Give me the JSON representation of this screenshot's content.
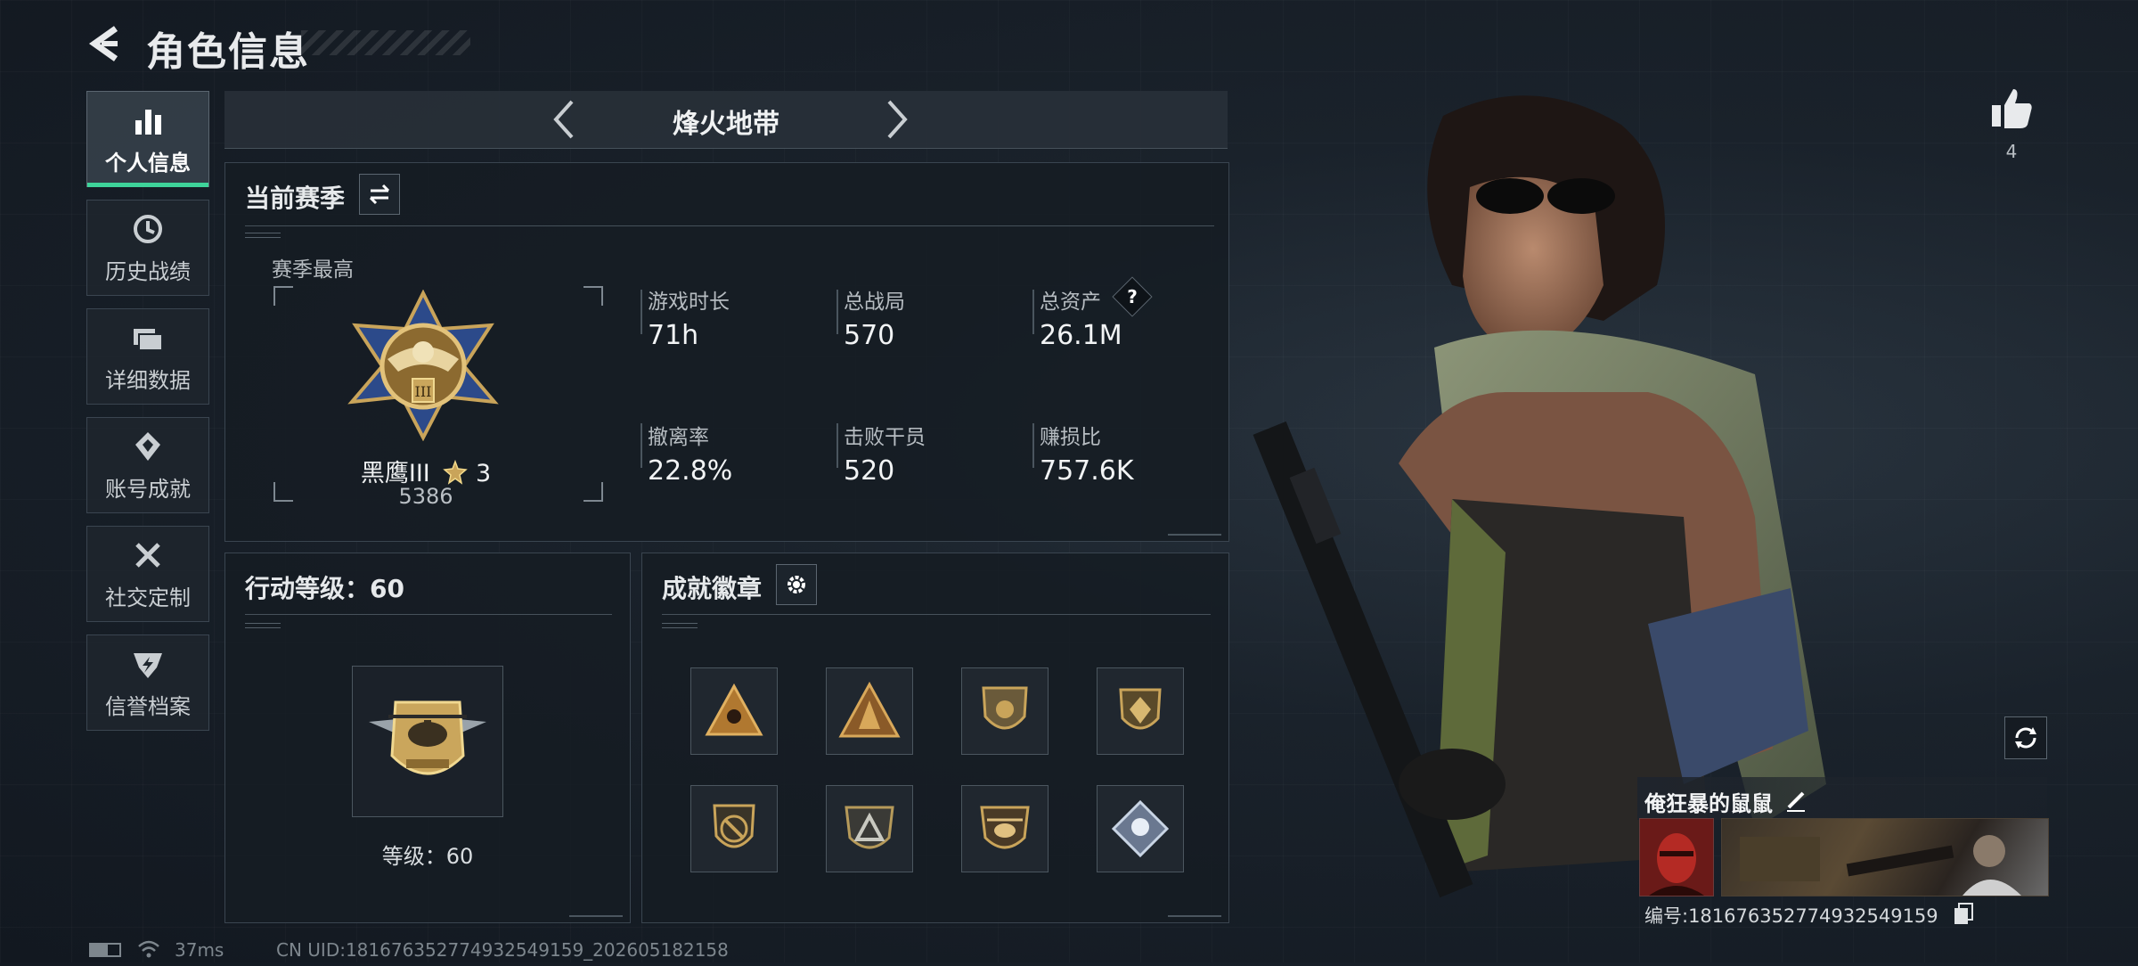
{
  "header": {
    "title": "角色信息"
  },
  "sidebar": {
    "items": [
      {
        "label": "个人信息"
      },
      {
        "label": "历史战绩"
      },
      {
        "label": "详细数据"
      },
      {
        "label": "账号成就"
      },
      {
        "label": "社交定制"
      },
      {
        "label": "信誉档案"
      }
    ]
  },
  "map_selector": {
    "name": "烽火地带"
  },
  "season": {
    "title": "当前赛季",
    "best_label": "赛季最高",
    "rank_name": "黑鹰III",
    "rank_stars": "3",
    "rank_points": "5386",
    "stats": [
      {
        "label": "游戏时长",
        "value": "71h"
      },
      {
        "label": "总战局",
        "value": "570"
      },
      {
        "label": "总资产",
        "value": "26.1M",
        "help": "?"
      },
      {
        "label": "撤离率",
        "value": "22.8%"
      },
      {
        "label": "击败干员",
        "value": "520"
      },
      {
        "label": "赚损比",
        "value": "757.6K"
      }
    ]
  },
  "action_level": {
    "title": "行动等级：60",
    "level_text": "等级：60"
  },
  "achievements": {
    "title": "成就徽章",
    "badges": [
      "badge-1",
      "badge-2",
      "badge-3",
      "badge-4",
      "badge-5",
      "badge-6",
      "badge-7",
      "badge-8"
    ]
  },
  "profile": {
    "likes": "4",
    "name": "俺狂暴的鼠鼠",
    "id_text": "编号:1816763527749325491​59"
  },
  "footer": {
    "ping": "37ms",
    "uid": "CN UID:1816763527749325491​59_202605182158"
  },
  "colors": {
    "accent": "#3ed39a",
    "gold": "#c9a45a"
  }
}
